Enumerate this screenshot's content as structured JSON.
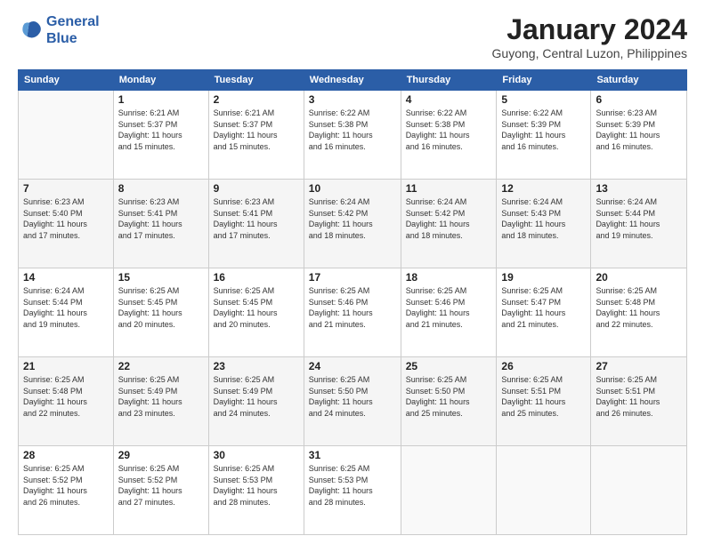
{
  "header": {
    "logo_line1": "General",
    "logo_line2": "Blue",
    "month": "January 2024",
    "location": "Guyong, Central Luzon, Philippines"
  },
  "days_of_week": [
    "Sunday",
    "Monday",
    "Tuesday",
    "Wednesday",
    "Thursday",
    "Friday",
    "Saturday"
  ],
  "weeks": [
    [
      {
        "num": "",
        "info": ""
      },
      {
        "num": "1",
        "info": "Sunrise: 6:21 AM\nSunset: 5:37 PM\nDaylight: 11 hours\nand 15 minutes."
      },
      {
        "num": "2",
        "info": "Sunrise: 6:21 AM\nSunset: 5:37 PM\nDaylight: 11 hours\nand 15 minutes."
      },
      {
        "num": "3",
        "info": "Sunrise: 6:22 AM\nSunset: 5:38 PM\nDaylight: 11 hours\nand 16 minutes."
      },
      {
        "num": "4",
        "info": "Sunrise: 6:22 AM\nSunset: 5:38 PM\nDaylight: 11 hours\nand 16 minutes."
      },
      {
        "num": "5",
        "info": "Sunrise: 6:22 AM\nSunset: 5:39 PM\nDaylight: 11 hours\nand 16 minutes."
      },
      {
        "num": "6",
        "info": "Sunrise: 6:23 AM\nSunset: 5:39 PM\nDaylight: 11 hours\nand 16 minutes."
      }
    ],
    [
      {
        "num": "7",
        "info": "Sunrise: 6:23 AM\nSunset: 5:40 PM\nDaylight: 11 hours\nand 17 minutes."
      },
      {
        "num": "8",
        "info": "Sunrise: 6:23 AM\nSunset: 5:41 PM\nDaylight: 11 hours\nand 17 minutes."
      },
      {
        "num": "9",
        "info": "Sunrise: 6:23 AM\nSunset: 5:41 PM\nDaylight: 11 hours\nand 17 minutes."
      },
      {
        "num": "10",
        "info": "Sunrise: 6:24 AM\nSunset: 5:42 PM\nDaylight: 11 hours\nand 18 minutes."
      },
      {
        "num": "11",
        "info": "Sunrise: 6:24 AM\nSunset: 5:42 PM\nDaylight: 11 hours\nand 18 minutes."
      },
      {
        "num": "12",
        "info": "Sunrise: 6:24 AM\nSunset: 5:43 PM\nDaylight: 11 hours\nand 18 minutes."
      },
      {
        "num": "13",
        "info": "Sunrise: 6:24 AM\nSunset: 5:44 PM\nDaylight: 11 hours\nand 19 minutes."
      }
    ],
    [
      {
        "num": "14",
        "info": "Sunrise: 6:24 AM\nSunset: 5:44 PM\nDaylight: 11 hours\nand 19 minutes."
      },
      {
        "num": "15",
        "info": "Sunrise: 6:25 AM\nSunset: 5:45 PM\nDaylight: 11 hours\nand 20 minutes."
      },
      {
        "num": "16",
        "info": "Sunrise: 6:25 AM\nSunset: 5:45 PM\nDaylight: 11 hours\nand 20 minutes."
      },
      {
        "num": "17",
        "info": "Sunrise: 6:25 AM\nSunset: 5:46 PM\nDaylight: 11 hours\nand 21 minutes."
      },
      {
        "num": "18",
        "info": "Sunrise: 6:25 AM\nSunset: 5:46 PM\nDaylight: 11 hours\nand 21 minutes."
      },
      {
        "num": "19",
        "info": "Sunrise: 6:25 AM\nSunset: 5:47 PM\nDaylight: 11 hours\nand 21 minutes."
      },
      {
        "num": "20",
        "info": "Sunrise: 6:25 AM\nSunset: 5:48 PM\nDaylight: 11 hours\nand 22 minutes."
      }
    ],
    [
      {
        "num": "21",
        "info": "Sunrise: 6:25 AM\nSunset: 5:48 PM\nDaylight: 11 hours\nand 22 minutes."
      },
      {
        "num": "22",
        "info": "Sunrise: 6:25 AM\nSunset: 5:49 PM\nDaylight: 11 hours\nand 23 minutes."
      },
      {
        "num": "23",
        "info": "Sunrise: 6:25 AM\nSunset: 5:49 PM\nDaylight: 11 hours\nand 24 minutes."
      },
      {
        "num": "24",
        "info": "Sunrise: 6:25 AM\nSunset: 5:50 PM\nDaylight: 11 hours\nand 24 minutes."
      },
      {
        "num": "25",
        "info": "Sunrise: 6:25 AM\nSunset: 5:50 PM\nDaylight: 11 hours\nand 25 minutes."
      },
      {
        "num": "26",
        "info": "Sunrise: 6:25 AM\nSunset: 5:51 PM\nDaylight: 11 hours\nand 25 minutes."
      },
      {
        "num": "27",
        "info": "Sunrise: 6:25 AM\nSunset: 5:51 PM\nDaylight: 11 hours\nand 26 minutes."
      }
    ],
    [
      {
        "num": "28",
        "info": "Sunrise: 6:25 AM\nSunset: 5:52 PM\nDaylight: 11 hours\nand 26 minutes."
      },
      {
        "num": "29",
        "info": "Sunrise: 6:25 AM\nSunset: 5:52 PM\nDaylight: 11 hours\nand 27 minutes."
      },
      {
        "num": "30",
        "info": "Sunrise: 6:25 AM\nSunset: 5:53 PM\nDaylight: 11 hours\nand 28 minutes."
      },
      {
        "num": "31",
        "info": "Sunrise: 6:25 AM\nSunset: 5:53 PM\nDaylight: 11 hours\nand 28 minutes."
      },
      {
        "num": "",
        "info": ""
      },
      {
        "num": "",
        "info": ""
      },
      {
        "num": "",
        "info": ""
      }
    ]
  ]
}
